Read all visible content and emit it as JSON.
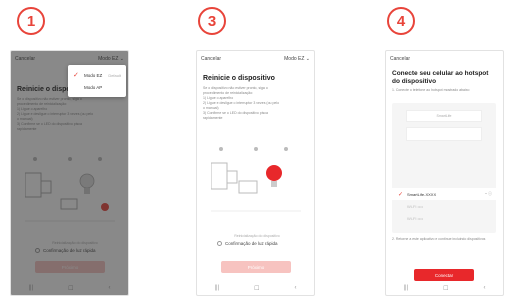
{
  "steps": [
    {
      "number": "1"
    },
    {
      "number": "3"
    },
    {
      "number": "4"
    }
  ],
  "screen_reset": {
    "cancel_label": "Cancelar",
    "mode_label": "Modo EZ ⌄",
    "title": "Reinicie o dispositivo",
    "instructions": [
      "Se o dispositivo não estiver pronto, siga o",
      "procedimento de reinicialização:",
      "1) Ligue o aparelho",
      "2) Ligue e desligue o interruptor 3 vezes (ou pelo",
      "   o manual)",
      "3) Confirme se o LED do dispositivo pisca",
      "   rapidamente"
    ],
    "confirm_hint": "Reinicialização do dispositivo",
    "confirm_label": "Confirmação de luz rápida",
    "next_label": "Próximo"
  },
  "dropdown": {
    "options": [
      {
        "label": "Modo EZ",
        "checked": true,
        "note": "Default"
      },
      {
        "label": "Modo AP",
        "checked": false,
        "note": ""
      }
    ]
  },
  "screen_wifi": {
    "cancel_label": "Cancelar",
    "title": "Conecte seu celular ao hotspot do dispositivo",
    "subtitle": "1. Conecte o telefone ao hotspot mostrado abaixo",
    "hotspot_label": "SmartLife",
    "networks": [
      {
        "label": "SmartLife-XXXX",
        "selected": true
      },
      {
        "label": "Wi-Fi ••••",
        "selected": false
      },
      {
        "label": "Wi-Fi ••••",
        "selected": false
      }
    ],
    "note": "2. Retorne a este aplicativo e continue incluindo dispositivos",
    "button_label": "Conectar"
  },
  "nav": {
    "menu_glyph": "|||",
    "home_glyph": "☐",
    "back_glyph": "‹"
  },
  "colors": {
    "accent": "#e8443a",
    "button_red": "#e8282b",
    "button_disabled": "#f7c3c0"
  }
}
